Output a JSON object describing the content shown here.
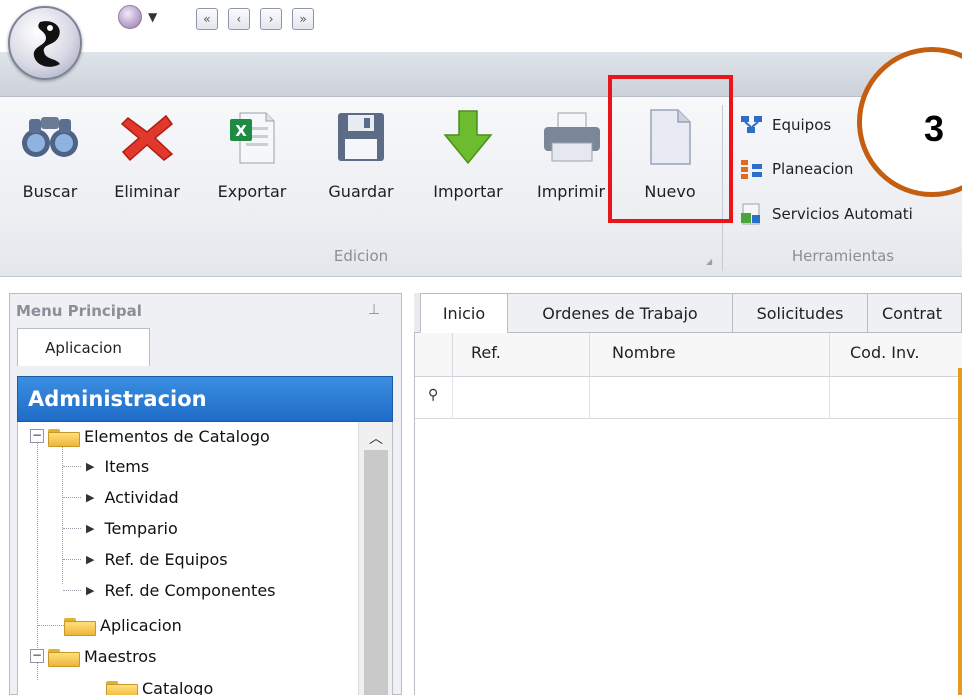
{
  "quick_access": {
    "icons": [
      "app-orb-icon",
      "dropdown-caret-icon",
      "first-record-icon",
      "previous-record-icon",
      "next-record-icon",
      "last-record-icon"
    ],
    "nav_glyphs": [
      "«",
      "‹",
      "›",
      "»"
    ]
  },
  "ribbon": {
    "edicion": {
      "label": "Edicion",
      "buttons": [
        {
          "label": "Buscar",
          "icon": "binoculars-icon"
        },
        {
          "label": "Eliminar",
          "icon": "delete-x-icon"
        },
        {
          "label": "Exportar",
          "icon": "excel-export-icon"
        },
        {
          "label": "Guardar",
          "icon": "floppy-disk-icon"
        },
        {
          "label": "Importar",
          "icon": "green-down-arrow-icon"
        },
        {
          "label": "Imprimir",
          "icon": "printer-icon"
        },
        {
          "label": "Nuevo",
          "icon": "new-document-icon"
        }
      ]
    },
    "herramientas": {
      "label": "Herramientas",
      "items": [
        {
          "label": "Equipos",
          "icon": "equipment-icon"
        },
        {
          "label": "Planeacion",
          "icon": "planning-icon"
        },
        {
          "label": "Servicios Automati",
          "icon": "automatic-services-icon"
        }
      ]
    }
  },
  "annotation": {
    "step_number": "3",
    "highlight_color": "#e8151a",
    "badge_color": "#c45f12"
  },
  "menu": {
    "title": "Menu Principal",
    "pin_glyph": "⊥",
    "tab": "Aplicacion",
    "section": "Administracion",
    "tree": [
      {
        "label": "Elementos de Catalogo",
        "type": "folder",
        "expanded": true
      },
      {
        "label": "Items",
        "type": "leaf"
      },
      {
        "label": "Actividad",
        "type": "leaf"
      },
      {
        "label": "Tempario",
        "type": "leaf"
      },
      {
        "label": "Ref. de Equipos",
        "type": "leaf"
      },
      {
        "label": "Ref. de Componentes",
        "type": "leaf"
      },
      {
        "label": "Aplicacion",
        "type": "folder"
      },
      {
        "label": "Maestros",
        "type": "folder",
        "expanded": true
      },
      {
        "label": "Catalogo",
        "type": "folder"
      }
    ]
  },
  "tabs": [
    "Inicio",
    "Ordenes de Trabajo",
    "Solicitudes",
    "Contrat"
  ],
  "grid": {
    "columns": [
      "Ref.",
      "Nombre",
      "Cod. Inv."
    ],
    "filter_glyph": "⚲",
    "rows": []
  },
  "colors": {
    "accent_blue": "#1f6cc8",
    "highlight_red": "#e8151a",
    "badge_orange": "#c45f12"
  }
}
